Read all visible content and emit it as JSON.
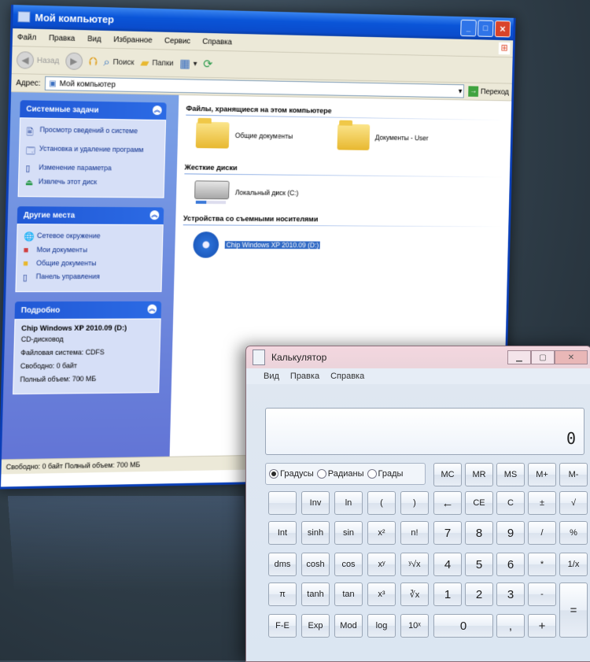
{
  "explorer": {
    "title": "Мой компьютер",
    "menu": [
      "Файл",
      "Правка",
      "Вид",
      "Избранное",
      "Сервис",
      "Справка"
    ],
    "toolbar": {
      "back": "Назад",
      "search": "Поиск",
      "folders": "Папки"
    },
    "address_label": "Адрес:",
    "address_value": "Мой компьютер",
    "go_label": "Переход",
    "system_tasks": {
      "title": "Системные задачи",
      "items": [
        "Просмотр сведений о системе",
        "Установка и удаление программ",
        "Изменение параметра",
        "Извлечь этот диск"
      ]
    },
    "other_places": {
      "title": "Другие места",
      "items": [
        "Сетевое окружение",
        "Мои документы",
        "Общие документы",
        "Панель управления"
      ]
    },
    "details": {
      "title": "Подробно",
      "name": "Chip Windows XP 2010.09 (D:)",
      "type": "CD-дисковод",
      "fs": "Файловая система: CDFS",
      "free": "Свободно: 0 байт",
      "total": "Полный объем: 700 МБ"
    },
    "groups": {
      "files_title": "Файлы, хранящиеся на этом компьютере",
      "shared_docs": "Общие документы",
      "user_docs": "Документы - User",
      "hdd_title": "Жесткие диски",
      "local_disk": "Локальный диск (C:)",
      "removable_title": "Устройства со съемными носителями",
      "cd_drive": "Chip Windows XP 2010.09 (D:)"
    },
    "local_disk_usage": 0.35,
    "status": "Свободно: 0 байт Полный объем: 700 МБ"
  },
  "calculator": {
    "title": "Калькулятор",
    "menu": [
      "Вид",
      "Правка",
      "Справка"
    ],
    "display": "0",
    "angle_modes": [
      "Градусы",
      "Радианы",
      "Грады"
    ],
    "selected_mode": "Градусы",
    "keys": {
      "mc": "MC",
      "mr": "MR",
      "ms": "MS",
      "mplus": "M+",
      "mminus": "M-",
      "inv": "Inv",
      "ln": "ln",
      "lparen": "(",
      "rparen": ")",
      "back": "←",
      "ce": "CE",
      "c": "C",
      "plusminus": "±",
      "sqrt": "√",
      "int": "Int",
      "sinh": "sinh",
      "sin": "sin",
      "x2": "x²",
      "nfact": "n!",
      "k7": "7",
      "k8": "8",
      "k9": "9",
      "div": "/",
      "pct": "%",
      "dms": "dms",
      "cosh": "cosh",
      "cos": "cos",
      "xy": "xʸ",
      "yroot": "ʸ√x",
      "k4": "4",
      "k5": "5",
      "k6": "6",
      "mul": "*",
      "recip": "1/x",
      "pi": "π",
      "tanh": "tanh",
      "tan": "tan",
      "x3": "x³",
      "cuberoot": "∛x",
      "k1": "1",
      "k2": "2",
      "k3": "3",
      "minus": "-",
      "eq": "=",
      "fe": "F-E",
      "exp": "Exp",
      "mod": "Mod",
      "log": "log",
      "pow10": "10ˣ",
      "k0": "0",
      "dot": ",",
      "plus": "+"
    }
  }
}
